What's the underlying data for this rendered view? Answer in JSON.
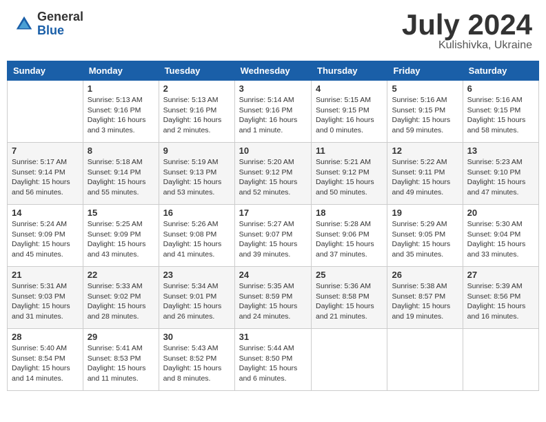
{
  "header": {
    "logo_general": "General",
    "logo_blue": "Blue",
    "title": "July 2024",
    "location": "Kulishivka, Ukraine"
  },
  "columns": [
    "Sunday",
    "Monday",
    "Tuesday",
    "Wednesday",
    "Thursday",
    "Friday",
    "Saturday"
  ],
  "weeks": [
    [
      {
        "day": "",
        "info": ""
      },
      {
        "day": "1",
        "info": "Sunrise: 5:13 AM\nSunset: 9:16 PM\nDaylight: 16 hours\nand 3 minutes."
      },
      {
        "day": "2",
        "info": "Sunrise: 5:13 AM\nSunset: 9:16 PM\nDaylight: 16 hours\nand 2 minutes."
      },
      {
        "day": "3",
        "info": "Sunrise: 5:14 AM\nSunset: 9:16 PM\nDaylight: 16 hours\nand 1 minute."
      },
      {
        "day": "4",
        "info": "Sunrise: 5:15 AM\nSunset: 9:15 PM\nDaylight: 16 hours\nand 0 minutes."
      },
      {
        "day": "5",
        "info": "Sunrise: 5:16 AM\nSunset: 9:15 PM\nDaylight: 15 hours\nand 59 minutes."
      },
      {
        "day": "6",
        "info": "Sunrise: 5:16 AM\nSunset: 9:15 PM\nDaylight: 15 hours\nand 58 minutes."
      }
    ],
    [
      {
        "day": "7",
        "info": "Sunrise: 5:17 AM\nSunset: 9:14 PM\nDaylight: 15 hours\nand 56 minutes."
      },
      {
        "day": "8",
        "info": "Sunrise: 5:18 AM\nSunset: 9:14 PM\nDaylight: 15 hours\nand 55 minutes."
      },
      {
        "day": "9",
        "info": "Sunrise: 5:19 AM\nSunset: 9:13 PM\nDaylight: 15 hours\nand 53 minutes."
      },
      {
        "day": "10",
        "info": "Sunrise: 5:20 AM\nSunset: 9:12 PM\nDaylight: 15 hours\nand 52 minutes."
      },
      {
        "day": "11",
        "info": "Sunrise: 5:21 AM\nSunset: 9:12 PM\nDaylight: 15 hours\nand 50 minutes."
      },
      {
        "day": "12",
        "info": "Sunrise: 5:22 AM\nSunset: 9:11 PM\nDaylight: 15 hours\nand 49 minutes."
      },
      {
        "day": "13",
        "info": "Sunrise: 5:23 AM\nSunset: 9:10 PM\nDaylight: 15 hours\nand 47 minutes."
      }
    ],
    [
      {
        "day": "14",
        "info": "Sunrise: 5:24 AM\nSunset: 9:09 PM\nDaylight: 15 hours\nand 45 minutes."
      },
      {
        "day": "15",
        "info": "Sunrise: 5:25 AM\nSunset: 9:09 PM\nDaylight: 15 hours\nand 43 minutes."
      },
      {
        "day": "16",
        "info": "Sunrise: 5:26 AM\nSunset: 9:08 PM\nDaylight: 15 hours\nand 41 minutes."
      },
      {
        "day": "17",
        "info": "Sunrise: 5:27 AM\nSunset: 9:07 PM\nDaylight: 15 hours\nand 39 minutes."
      },
      {
        "day": "18",
        "info": "Sunrise: 5:28 AM\nSunset: 9:06 PM\nDaylight: 15 hours\nand 37 minutes."
      },
      {
        "day": "19",
        "info": "Sunrise: 5:29 AM\nSunset: 9:05 PM\nDaylight: 15 hours\nand 35 minutes."
      },
      {
        "day": "20",
        "info": "Sunrise: 5:30 AM\nSunset: 9:04 PM\nDaylight: 15 hours\nand 33 minutes."
      }
    ],
    [
      {
        "day": "21",
        "info": "Sunrise: 5:31 AM\nSunset: 9:03 PM\nDaylight: 15 hours\nand 31 minutes."
      },
      {
        "day": "22",
        "info": "Sunrise: 5:33 AM\nSunset: 9:02 PM\nDaylight: 15 hours\nand 28 minutes."
      },
      {
        "day": "23",
        "info": "Sunrise: 5:34 AM\nSunset: 9:01 PM\nDaylight: 15 hours\nand 26 minutes."
      },
      {
        "day": "24",
        "info": "Sunrise: 5:35 AM\nSunset: 8:59 PM\nDaylight: 15 hours\nand 24 minutes."
      },
      {
        "day": "25",
        "info": "Sunrise: 5:36 AM\nSunset: 8:58 PM\nDaylight: 15 hours\nand 21 minutes."
      },
      {
        "day": "26",
        "info": "Sunrise: 5:38 AM\nSunset: 8:57 PM\nDaylight: 15 hours\nand 19 minutes."
      },
      {
        "day": "27",
        "info": "Sunrise: 5:39 AM\nSunset: 8:56 PM\nDaylight: 15 hours\nand 16 minutes."
      }
    ],
    [
      {
        "day": "28",
        "info": "Sunrise: 5:40 AM\nSunset: 8:54 PM\nDaylight: 15 hours\nand 14 minutes."
      },
      {
        "day": "29",
        "info": "Sunrise: 5:41 AM\nSunset: 8:53 PM\nDaylight: 15 hours\nand 11 minutes."
      },
      {
        "day": "30",
        "info": "Sunrise: 5:43 AM\nSunset: 8:52 PM\nDaylight: 15 hours\nand 8 minutes."
      },
      {
        "day": "31",
        "info": "Sunrise: 5:44 AM\nSunset: 8:50 PM\nDaylight: 15 hours\nand 6 minutes."
      },
      {
        "day": "",
        "info": ""
      },
      {
        "day": "",
        "info": ""
      },
      {
        "day": "",
        "info": ""
      }
    ]
  ]
}
